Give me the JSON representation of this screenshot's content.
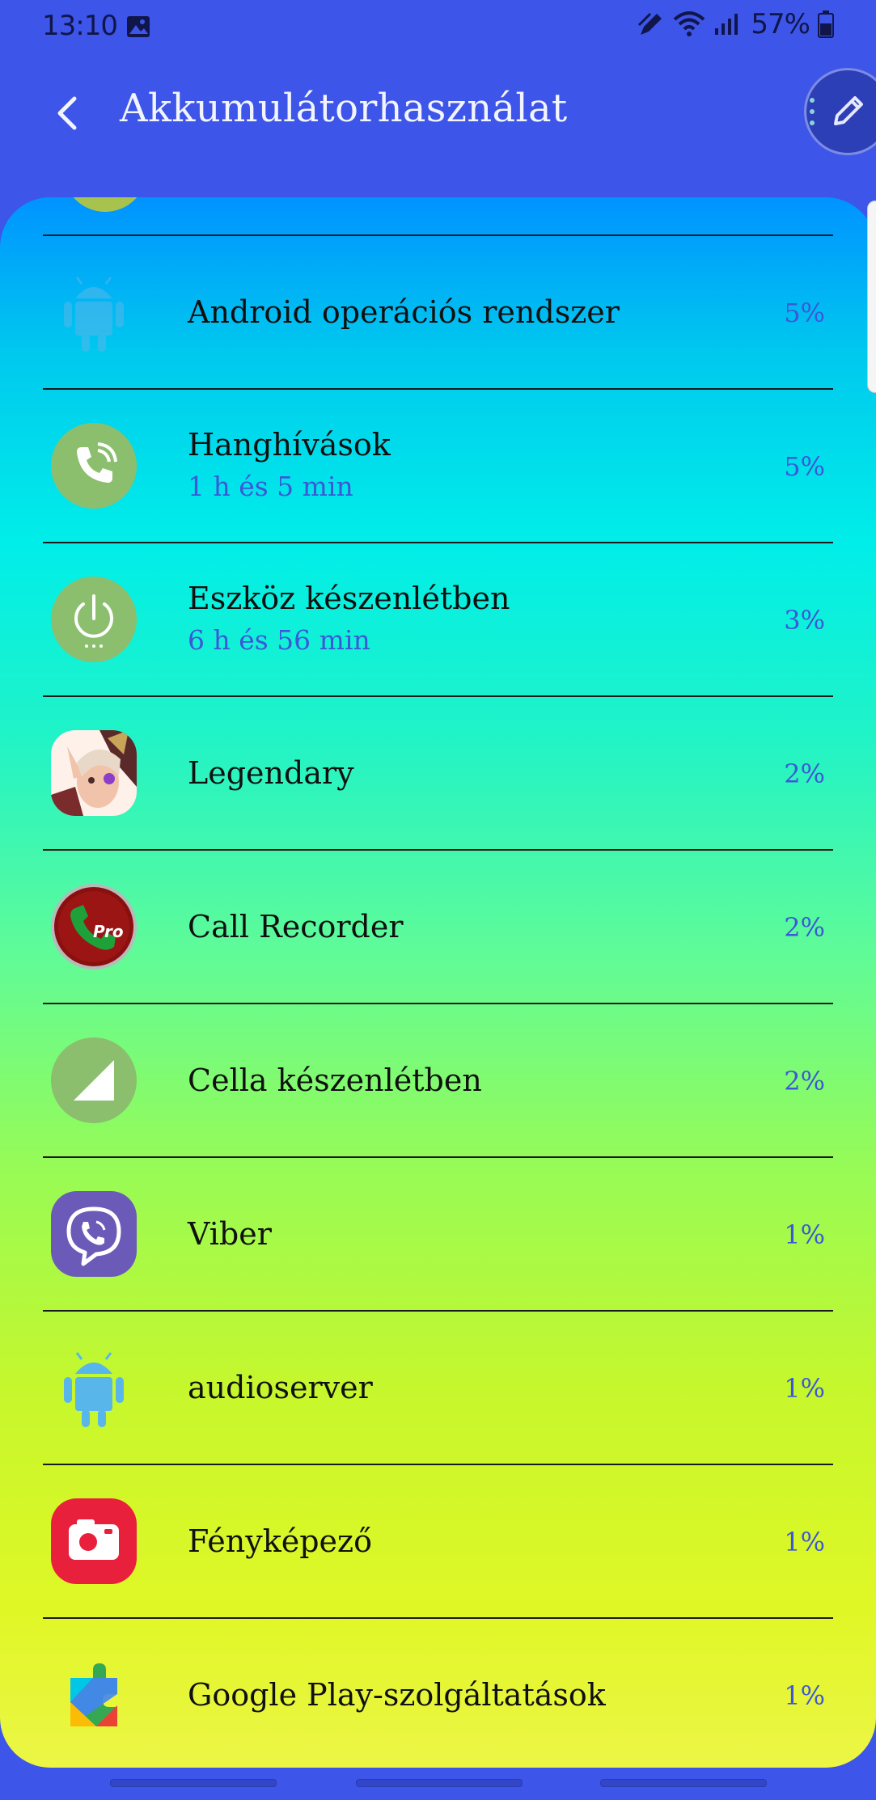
{
  "status_bar": {
    "time": "13:10",
    "battery": "57%",
    "icons": [
      "gallery-icon",
      "pen-icon",
      "wifi-icon",
      "signal-icon",
      "battery-icon"
    ]
  },
  "header": {
    "title": "Akkumulátorhasználat",
    "back_icon": "chevron-left-icon",
    "edit_icon": "pencil-icon"
  },
  "colors": {
    "header_bg": "#3d55e8",
    "accent_text": "#3c58d6",
    "card_gradient_top": "#0093ff",
    "card_gradient_bottom": "#ecf646"
  },
  "items": [
    {
      "label": "Android operációs rendszer",
      "sub": "",
      "percent": "5%",
      "icon": "android-icon"
    },
    {
      "label": "Hanghívások",
      "sub": "1 h és 5 min",
      "percent": "5%",
      "icon": "phone-call-icon"
    },
    {
      "label": "Eszköz készenlétben",
      "sub": "6 h és 56 min",
      "percent": "3%",
      "icon": "power-icon"
    },
    {
      "label": "Legendary",
      "sub": "",
      "percent": "2%",
      "icon": "legendary-game-icon"
    },
    {
      "label": "Call Recorder",
      "sub": "",
      "percent": "2%",
      "icon": "call-recorder-pro-icon"
    },
    {
      "label": "Cella készenlétben",
      "sub": "",
      "percent": "2%",
      "icon": "cell-signal-icon"
    },
    {
      "label": "Viber",
      "sub": "",
      "percent": "1%",
      "icon": "viber-icon"
    },
    {
      "label": "audioserver",
      "sub": "",
      "percent": "1%",
      "icon": "android-icon"
    },
    {
      "label": "Fényképező",
      "sub": "",
      "percent": "1%",
      "icon": "camera-icon"
    },
    {
      "label": "Google Play-szolgáltatások",
      "sub": "",
      "percent": "1%",
      "icon": "google-play-services-icon"
    }
  ]
}
